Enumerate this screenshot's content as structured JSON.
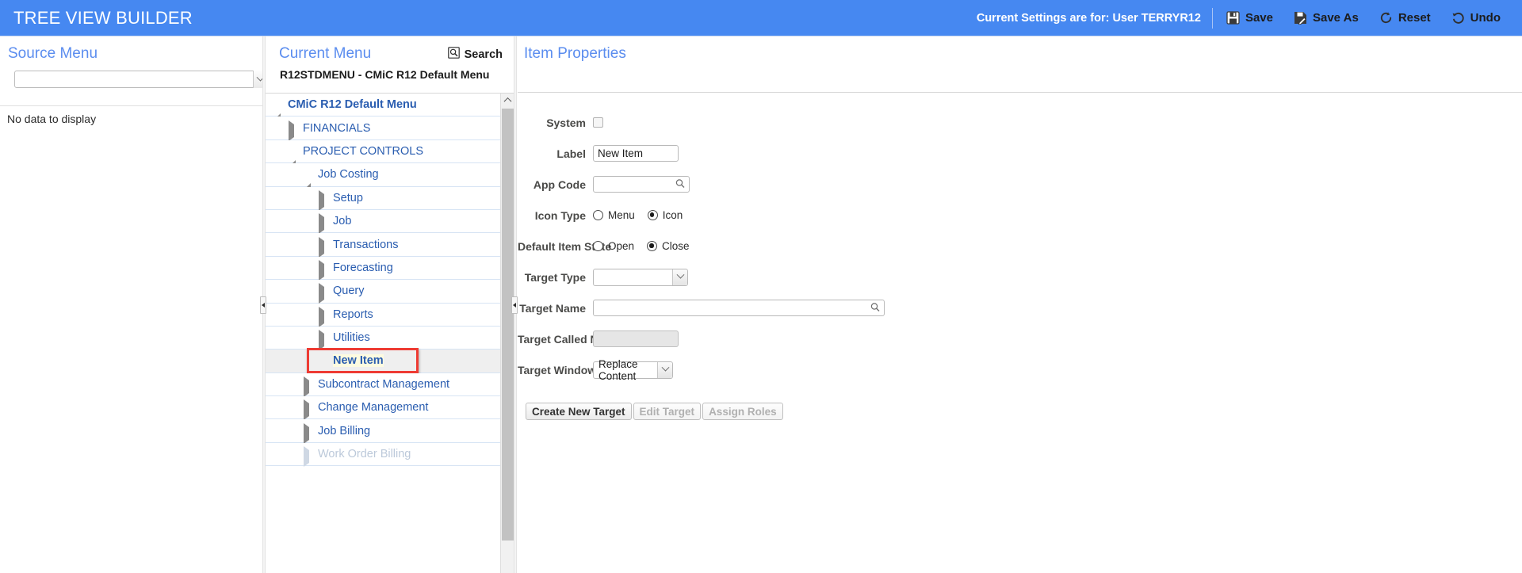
{
  "header": {
    "app_title": "TREE VIEW BUILDER",
    "settings_text": "Current Settings are for: User TERRYR12",
    "actions": [
      {
        "label": "Save",
        "icon": "floppy-disk-icon"
      },
      {
        "label": "Save As",
        "icon": "floppy-disk-pencil-icon"
      },
      {
        "label": "Reset",
        "icon": "circular-arrow-icon"
      },
      {
        "label": "Undo",
        "icon": "undo-arrow-icon"
      }
    ],
    "bar_color": "#4688f1"
  },
  "source_panel": {
    "title": "Source Menu",
    "select_value": "",
    "no_data_text": "No data to display"
  },
  "current_panel": {
    "title": "Current Menu",
    "search_label": "Search",
    "menu_code": "R12STDMENU - CMiC R12 Default Menu",
    "tree": [
      {
        "label": "CMiC R12 Default Menu",
        "depth": 0,
        "state": "expanded",
        "style": "root"
      },
      {
        "label": "FINANCIALS",
        "depth": 1,
        "state": "collapsed",
        "style": "normal"
      },
      {
        "label": "PROJECT CONTROLS",
        "depth": 1,
        "state": "expanded",
        "style": "normal"
      },
      {
        "label": "Job Costing",
        "depth": 2,
        "state": "expanded",
        "style": "normal"
      },
      {
        "label": "Setup",
        "depth": 3,
        "state": "collapsed",
        "style": "normal"
      },
      {
        "label": "Job",
        "depth": 3,
        "state": "collapsed",
        "style": "normal"
      },
      {
        "label": "Transactions",
        "depth": 3,
        "state": "collapsed",
        "style": "normal"
      },
      {
        "label": "Forecasting",
        "depth": 3,
        "state": "collapsed",
        "style": "normal"
      },
      {
        "label": "Query",
        "depth": 3,
        "state": "collapsed",
        "style": "normal"
      },
      {
        "label": "Reports",
        "depth": 3,
        "state": "collapsed",
        "style": "normal"
      },
      {
        "label": "Utilities",
        "depth": 3,
        "state": "collapsed",
        "style": "normal"
      },
      {
        "label": "New Item",
        "depth": 3,
        "state": "leaf",
        "style": "selected"
      },
      {
        "label": "Subcontract Management",
        "depth": 2,
        "state": "collapsed",
        "style": "normal"
      },
      {
        "label": "Change Management",
        "depth": 2,
        "state": "collapsed",
        "style": "normal"
      },
      {
        "label": "Job Billing",
        "depth": 2,
        "state": "collapsed",
        "style": "normal"
      },
      {
        "label": "Work Order Billing",
        "depth": 2,
        "state": "collapsed",
        "style": "dim"
      }
    ],
    "highlight_color": "#ee3b33"
  },
  "item_properties": {
    "title": "Item Properties",
    "fields": {
      "system_label": "System",
      "system_checked": false,
      "label_label": "Label",
      "label_value": "New Item",
      "app_code_label": "App Code",
      "app_code_value": "",
      "icon_type_label": "Icon Type",
      "icon_type_options": [
        "Menu",
        "Icon"
      ],
      "icon_type_selected": "Icon",
      "default_item_state_label": "Default Item State",
      "default_item_state_options": [
        "Open",
        "Close"
      ],
      "default_item_state_selected": "Close",
      "target_type_label": "Target Type",
      "target_type_value": "",
      "target_name_label": "Target Name",
      "target_name_value": "",
      "target_called_name_label": "Target Called Name",
      "target_called_name_value": "",
      "target_window_label": "Target Window",
      "target_window_value": "Replace Content"
    },
    "buttons": [
      {
        "label": "Create New Target",
        "enabled": true
      },
      {
        "label": "Edit Target",
        "enabled": false
      },
      {
        "label": "Assign Roles",
        "enabled": false
      }
    ]
  }
}
